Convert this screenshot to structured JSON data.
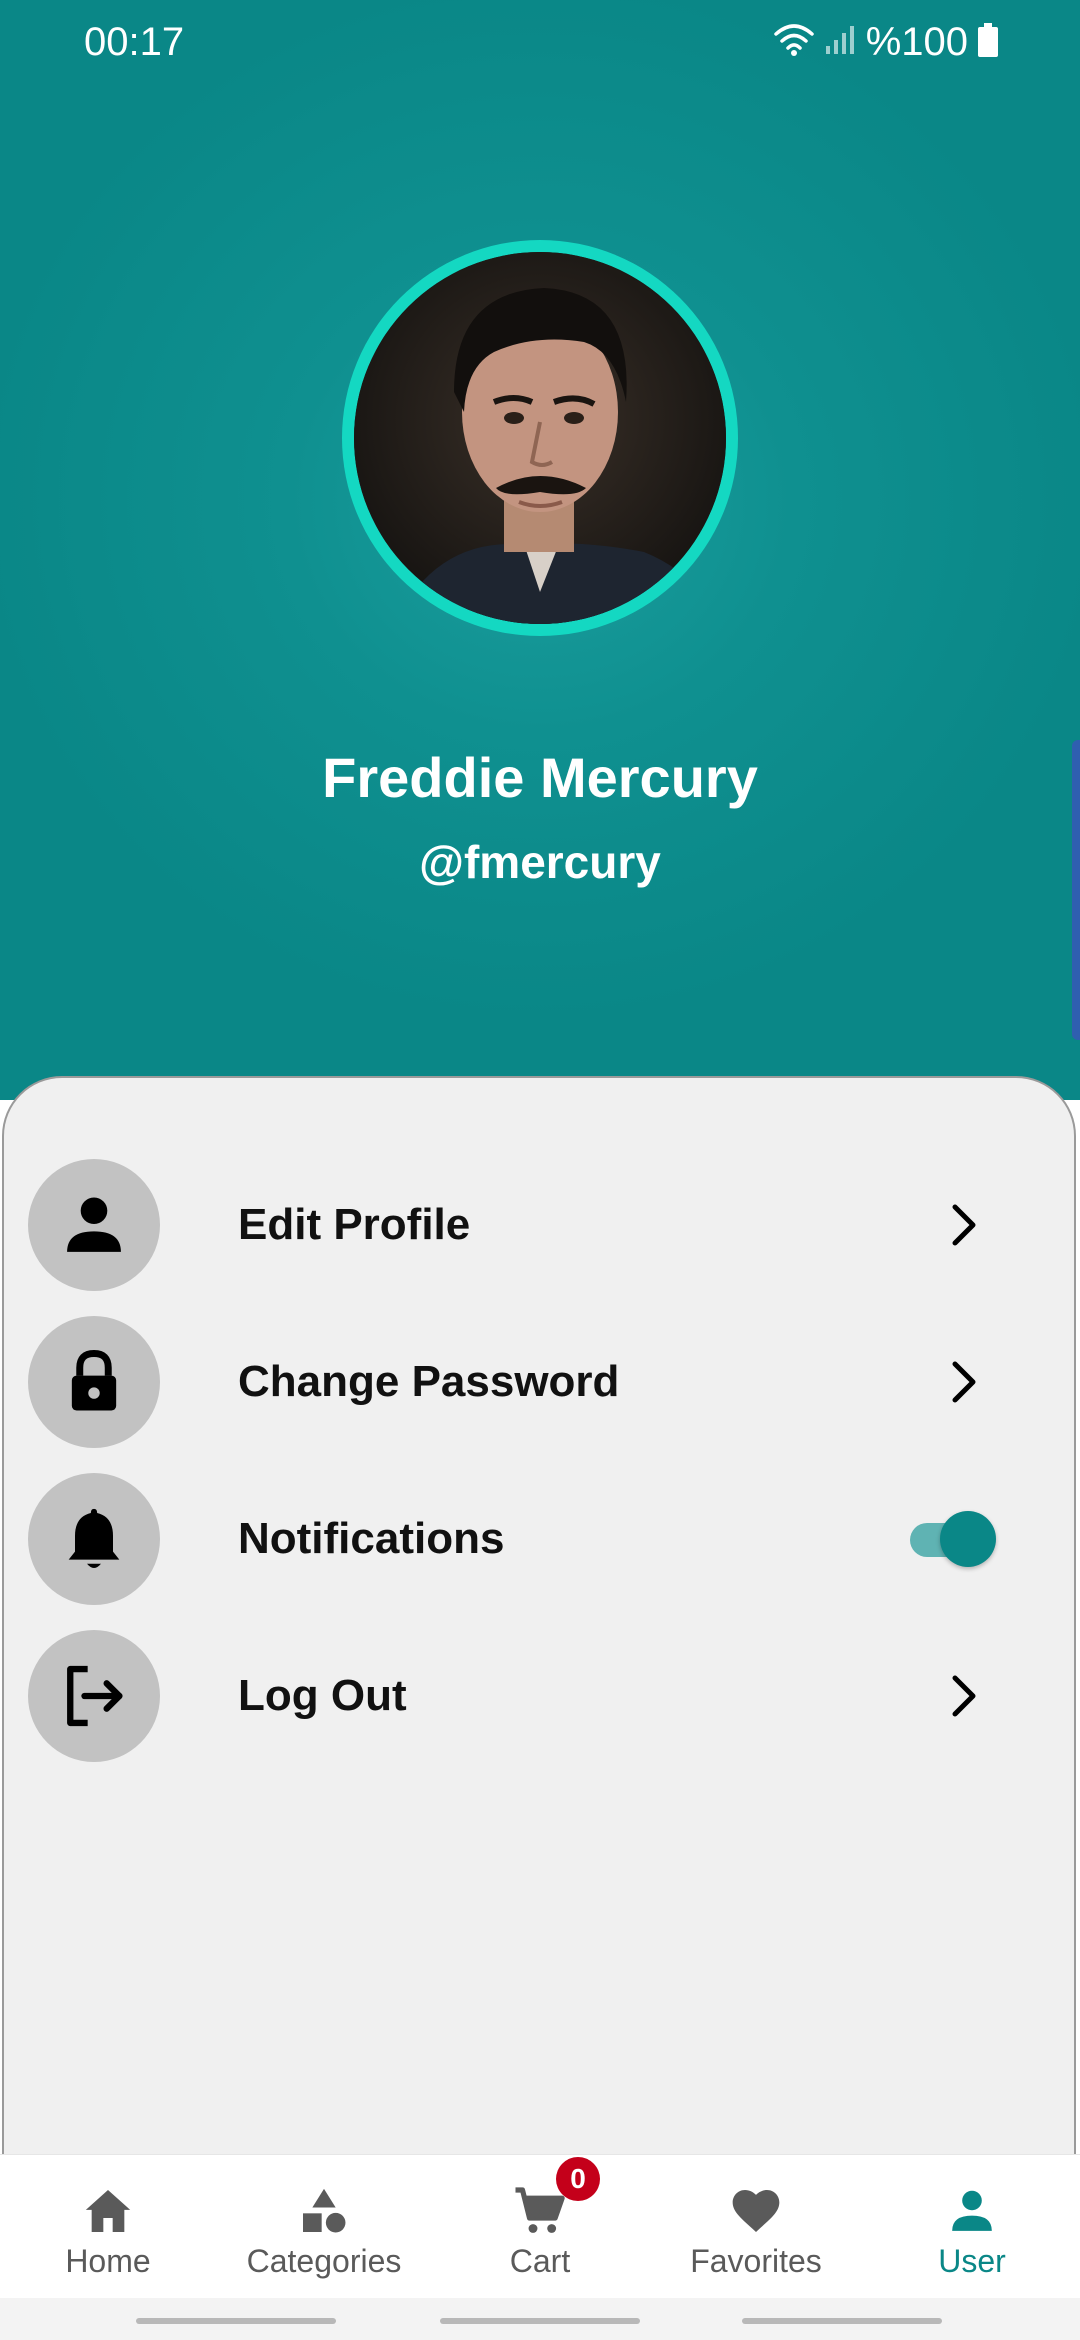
{
  "status_bar": {
    "time": "00:17",
    "battery": "%100",
    "icons": [
      "wifi-icon",
      "signal-icon",
      "battery-icon"
    ]
  },
  "profile": {
    "name": "Freddie Mercury",
    "username": "@fmercury",
    "avatar_icon": "profile-photo"
  },
  "menu": {
    "items": [
      {
        "label": "Edit Profile",
        "icon": "person-icon",
        "trailing": "chevron"
      },
      {
        "label": "Change Password",
        "icon": "lock-icon",
        "trailing": "chevron"
      },
      {
        "label": "Notifications",
        "icon": "bell-icon",
        "trailing": "toggle",
        "enabled": true
      },
      {
        "label": "Log Out",
        "icon": "logout-icon",
        "trailing": "chevron"
      }
    ]
  },
  "bottom_nav": {
    "items": [
      {
        "label": "Home",
        "icon": "home-icon",
        "active": false
      },
      {
        "label": "Categories",
        "icon": "categories-icon",
        "active": false
      },
      {
        "label": "Cart",
        "icon": "cart-icon",
        "active": false,
        "badge": "0"
      },
      {
        "label": "Favorites",
        "icon": "heart-icon",
        "active": false
      },
      {
        "label": "User",
        "icon": "user-icon",
        "active": true
      }
    ]
  },
  "colors": {
    "header": "#0a8787",
    "avatar_ring": "#14d8c2",
    "accent": "#0a8787",
    "badge": "#c4001a",
    "panel": "#f0f0f0"
  }
}
